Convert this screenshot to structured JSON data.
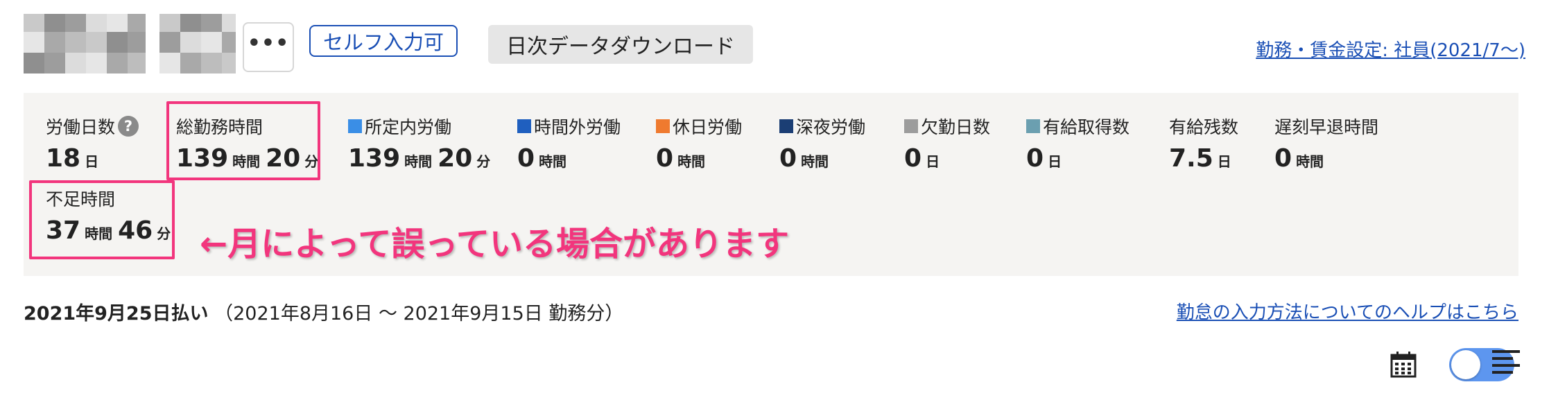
{
  "header": {
    "self_entry_badge": "セルフ入力可",
    "download_button": "日次データダウンロード",
    "settings_link": "勤務・賃金設定: 社員(2021/7〜)",
    "more_label": "•••"
  },
  "summary": [
    {
      "key": "work_days",
      "label": "労働日数",
      "values": [
        {
          "num": "18",
          "unit": "日"
        }
      ],
      "help": true
    },
    {
      "key": "total_hours",
      "label": "総勤務時間",
      "values": [
        {
          "num": "139",
          "unit": "時間"
        },
        {
          "num": "20",
          "unit": "分"
        }
      ],
      "highlighted": true
    },
    {
      "key": "scheduled",
      "label": "所定内労働",
      "color": "#3a8ee6",
      "values": [
        {
          "num": "139",
          "unit": "時間"
        },
        {
          "num": "20",
          "unit": "分"
        }
      ]
    },
    {
      "key": "overtime",
      "label": "時間外労働",
      "color": "#1f5fbf",
      "values": [
        {
          "num": "0",
          "unit": "時間"
        }
      ]
    },
    {
      "key": "holiday",
      "label": "休日労働",
      "color": "#ef7a2f",
      "values": [
        {
          "num": "0",
          "unit": "時間"
        }
      ]
    },
    {
      "key": "night",
      "label": "深夜労働",
      "color": "#1b3e74",
      "values": [
        {
          "num": "0",
          "unit": "時間"
        }
      ]
    },
    {
      "key": "absence",
      "label": "欠勤日数",
      "color": "#9c9c9c",
      "values": [
        {
          "num": "0",
          "unit": "日"
        }
      ]
    },
    {
      "key": "paid_leave_taken",
      "label": "有給取得数",
      "color": "#6b9fb0",
      "values": [
        {
          "num": "0",
          "unit": "日"
        }
      ]
    },
    {
      "key": "paid_leave_remaining",
      "label": "有給残数",
      "values": [
        {
          "num": "7.5",
          "unit": "日"
        }
      ]
    },
    {
      "key": "late_early",
      "label": "遅刻早退時間",
      "values": [
        {
          "num": "0",
          "unit": "時間"
        }
      ]
    },
    {
      "key": "shortage",
      "label": "不足時間",
      "values": [
        {
          "num": "37",
          "unit": "時間"
        },
        {
          "num": "46",
          "unit": "分"
        }
      ],
      "highlighted": true
    }
  ],
  "annotation": "←月によって誤っている場合があります",
  "pay": {
    "date": "2021年9月25日払い",
    "period": "（2021年8月16日 〜 2021年9月15日 勤務分）",
    "help_link": "勤怠の入力方法についてのヘルプはこちら"
  },
  "colors": {
    "link": "#1a4fb5",
    "highlight": "#f2357d",
    "toggle": "#5d96ef",
    "panel_bg": "#f5f4f2"
  },
  "icons": [
    "more-icon",
    "help-icon",
    "calendar-icon",
    "list-icon"
  ]
}
